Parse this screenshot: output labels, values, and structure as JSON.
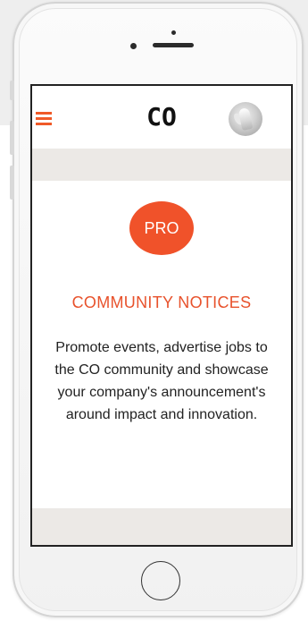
{
  "header": {
    "logo": "CO",
    "menu_icon": "hamburger-icon",
    "avatar_icon": "profile-avatar"
  },
  "main": {
    "badge": "PRO",
    "title": "COMMUNITY NOTICES",
    "description": "Promote events, advertise jobs to the CO community and showcase your company's announcement's around impact and innovation."
  },
  "colors": {
    "accent": "#f0522a",
    "band": "#ece9e6",
    "text": "#222222"
  }
}
